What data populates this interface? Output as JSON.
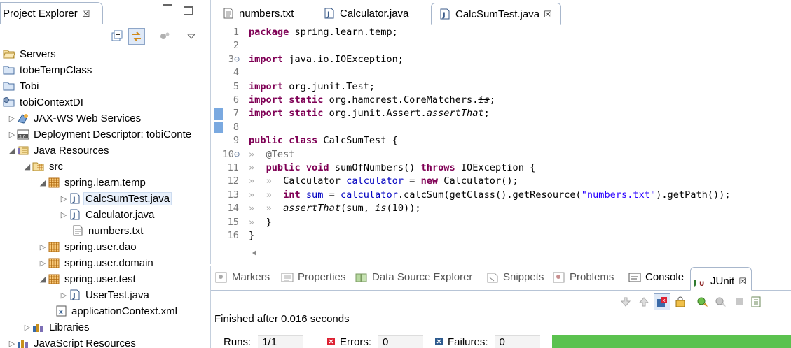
{
  "project_explorer": {
    "title": "Project Explorer",
    "close": "☒",
    "tree": [
      {
        "label": "Servers",
        "icon": "folder-open-icon"
      },
      {
        "label": "tobeTempClass",
        "icon": "project-icon"
      },
      {
        "label": "Tobi",
        "icon": "project-icon"
      },
      {
        "label": "tobiContextDI",
        "icon": "java-project-icon"
      },
      {
        "label": "JAX-WS Web Services",
        "icon": "web-services-icon"
      },
      {
        "label": "Deployment Descriptor: tobiConte",
        "icon": "deployment-descriptor-icon"
      },
      {
        "label": "Java Resources",
        "icon": "java-resources-icon"
      },
      {
        "label": "src",
        "icon": "source-folder-icon"
      },
      {
        "label": "spring.learn.temp",
        "icon": "package-icon"
      },
      {
        "label": "CalcSumTest.java",
        "icon": "java-file-icon"
      },
      {
        "label": "Calculator.java",
        "icon": "java-file-icon"
      },
      {
        "label": "numbers.txt",
        "icon": "text-file-icon"
      },
      {
        "label": "spring.user.dao",
        "icon": "package-icon"
      },
      {
        "label": "spring.user.domain",
        "icon": "package-icon"
      },
      {
        "label": "spring.user.test",
        "icon": "package-icon"
      },
      {
        "label": "UserTest.java",
        "icon": "java-file-icon"
      },
      {
        "label": "applicationContext.xml",
        "icon": "xml-file-icon"
      },
      {
        "label": "Libraries",
        "icon": "libraries-icon"
      },
      {
        "label": "JavaScript Resources",
        "icon": "javascript-resources-icon"
      }
    ]
  },
  "editor": {
    "tabs": [
      {
        "label": "numbers.txt",
        "icon": "text-file-icon"
      },
      {
        "label": "Calculator.java",
        "icon": "java-file-icon"
      },
      {
        "label": "CalcSumTest.java",
        "icon": "java-file-icon",
        "close": "☒"
      }
    ],
    "line_numbers": [
      "1",
      "2",
      "3",
      "4",
      "5",
      "6",
      "7",
      "8",
      "9",
      "10",
      "11",
      "12",
      "13",
      "14",
      "15",
      "16"
    ],
    "fold_markers": {
      "3": "⊖",
      "10": "⊖"
    },
    "code": {
      "l1a": "package",
      "l1b": " spring.learn.temp;",
      "l3a": "import",
      "l3b": " java.io.IOException;",
      "l5a": "import",
      "l5b": " org.junit.Test;",
      "l6a": "import",
      "l6b": "static",
      "l6c": " org.hamcrest.CoreMatchers.",
      "l6d": "is",
      "l6e": ";",
      "l7a": "import",
      "l7b": "static",
      "l7c": " org.junit.Assert.",
      "l7d": "assertThat",
      "l7e": ";",
      "l9a": "public",
      "l9b": "class",
      "l9c": " CalcSumTest {",
      "l10a": "@Test",
      "l11a": "public",
      "l11b": "void",
      "l11c": " sumOfNumbers() ",
      "l11d": "throws",
      "l11e": " IOException {",
      "l12a": "Calculator ",
      "l12b": "calculator",
      "l12c": " = ",
      "l12d": "new",
      "l12e": " Calculator();",
      "l13a": "int",
      "l13b": " sum",
      "l13c": " = ",
      "l13d": "calculator",
      "l13e": ".calcSum(getClass().getResource(",
      "l13f": "\"numbers.txt\"",
      "l13g": ").getPath());",
      "l14a": "assertThat",
      "l14b": "(sum, ",
      "l14c": "is",
      "l14d": "(10));",
      "l15a": "}",
      "l16a": "}"
    },
    "indent_marker": "»"
  },
  "bottom_panel": {
    "tabs": [
      {
        "label": "Markers",
        "icon": "markers-icon"
      },
      {
        "label": "Properties",
        "icon": "properties-icon"
      },
      {
        "label": "Data Source Explorer",
        "icon": "data-source-icon"
      },
      {
        "label": "Snippets",
        "icon": "snippets-icon"
      },
      {
        "label": "Problems",
        "icon": "problems-icon"
      },
      {
        "label": "Console",
        "icon": "console-icon"
      },
      {
        "label": "JUnit",
        "icon": "junit-icon",
        "close": "☒"
      }
    ],
    "status": "Finished after 0.016 seconds",
    "runs_label": "Runs:",
    "runs_value": "1/1",
    "errors_label": "Errors:",
    "errors_value": "0",
    "failures_label": "Failures:",
    "failures_value": "0",
    "colors": {
      "success_bar": "#5bc24f",
      "keyword": "#7f0055",
      "string": "#2a00ff",
      "field": "#0000c0"
    }
  }
}
